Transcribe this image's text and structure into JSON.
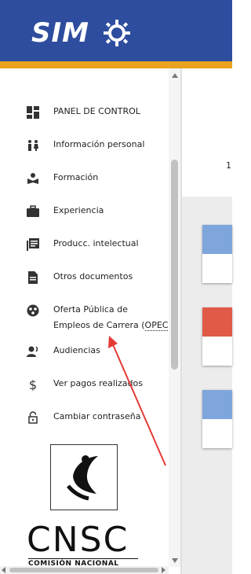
{
  "header": {
    "logo_text": "SIM",
    "brand_color": "#2f4d9e",
    "stripe_color": "#e9a31f"
  },
  "sidebar": {
    "items": [
      {
        "label": "PANEL DE CONTROL",
        "icon": "dashboard-icon"
      },
      {
        "label": "Información personal",
        "icon": "people-icon"
      },
      {
        "label": "Formación",
        "icon": "school-icon"
      },
      {
        "label": "Experiencia",
        "icon": "briefcase-icon"
      },
      {
        "label": "Producc. intelectual",
        "icon": "library-books-icon"
      },
      {
        "label": "Otros documentos",
        "icon": "document-icon"
      },
      {
        "label": "Oferta Pública de",
        "label_line2": "Empleos de Carrera (",
        "label_abbr": "OPEC",
        "label_end": ")",
        "icon": "globe-icon"
      },
      {
        "label": "Audiencias",
        "icon": "voice-icon"
      },
      {
        "label": "Ver pagos realizados",
        "icon": "dollar-icon"
      },
      {
        "label": "Cambiar contraseña",
        "icon": "lock-icon"
      }
    ]
  },
  "footer_logo": {
    "name": "CNSC",
    "subtitle": "COMISIÓN NACIONAL"
  },
  "main": {
    "peek_text": "1",
    "card_colors": [
      "#7ea6dc",
      "#e05a47",
      "#7ea6dc"
    ]
  },
  "annotation": {
    "arrow_color": "#e53935"
  }
}
